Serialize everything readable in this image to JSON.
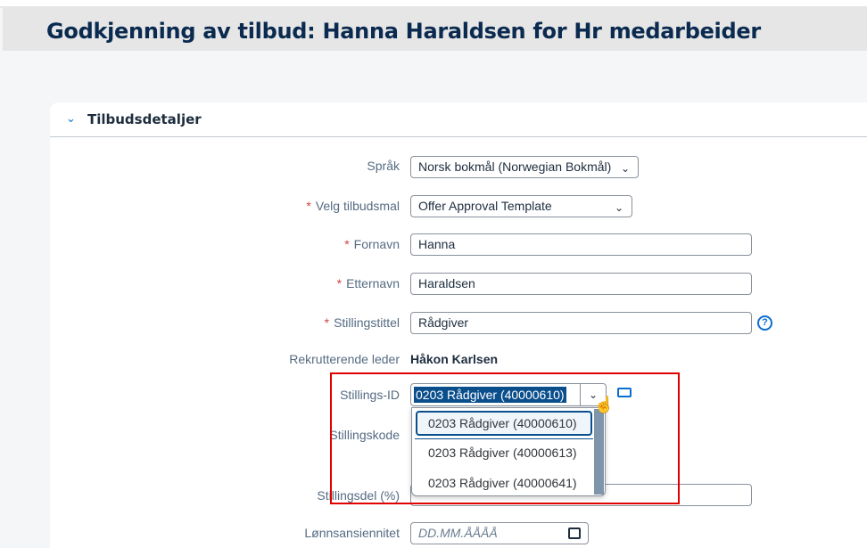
{
  "page": {
    "title": "Godkjenning av tilbud: Hanna Haraldsen for Hr medarbeider"
  },
  "section": {
    "title": "Tilbudsdetaljer"
  },
  "form": {
    "language": {
      "label": "Språk",
      "value": "Norsk bokmål (Norwegian Bokmål)"
    },
    "template": {
      "label": "Velg tilbudsmal",
      "value": "Offer Approval Template"
    },
    "first_name": {
      "label": "Fornavn",
      "value": "Hanna"
    },
    "last_name": {
      "label": "Etternavn",
      "value": "Haraldsen"
    },
    "job_title": {
      "label": "Stillingstittel",
      "value": "Rådgiver"
    },
    "recruiter": {
      "label": "Rekrutterende leder",
      "value": "Håkon Karlsen"
    },
    "position_id": {
      "label": "Stillings-ID",
      "value": "0203 Rådgiver (40000610)",
      "options": [
        "0203 Rådgiver (40000610)",
        "0203 Rådgiver (40000613)",
        "0203 Rådgiver (40000641)"
      ]
    },
    "position_code": {
      "label": "Stillingskode"
    },
    "fte": {
      "label": "Stillingsdel (%)"
    },
    "seniority": {
      "label": "Lønnsansiennitet",
      "placeholder": "DD.MM.ÅÅÅÅ"
    },
    "required_mark": "*"
  },
  "colors": {
    "accent": "#0a6ed1",
    "title": "#0a2a4f",
    "highlight": "#e00000"
  }
}
